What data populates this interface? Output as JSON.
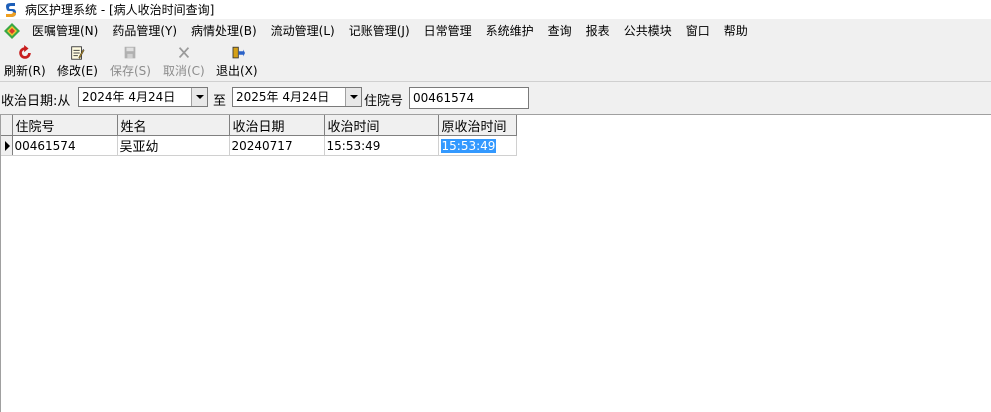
{
  "window": {
    "title": "病区护理系统 - [病人收治时间查询]"
  },
  "menubar": {
    "items": [
      "医嘱管理(N)",
      "药品管理(Y)",
      "病情处理(B)",
      "流动管理(L)",
      "记账管理(J)",
      "日常管理",
      "系统维护",
      "查询",
      "报表",
      "公共模块",
      "窗口",
      "帮助"
    ]
  },
  "toolbar": {
    "refresh_label": "刷新(R)",
    "edit_label": "修改(E)",
    "save_label": "保存(S)",
    "cancel_label": "取消(C)",
    "exit_label": "退出(X)",
    "save_enabled": false,
    "cancel_enabled": false
  },
  "filter": {
    "date_label": "收治日期:从",
    "from_date": "2024年 4月24日",
    "to_label": "至",
    "to_date": "2025年 4月24日",
    "inpatient_label": "住院号",
    "inpatient_value": "00461574"
  },
  "grid": {
    "columns": [
      "住院号",
      "姓名",
      "收治日期",
      "收治时间",
      "原收治时间"
    ],
    "rows": [
      {
        "inpatient_no": "00461574",
        "name": "吴亚幼",
        "admit_date": "20240717",
        "admit_time": "15:53:49",
        "orig_admit_time": "15:53:49"
      }
    ],
    "selection_color": "#3399ff"
  },
  "icons": {
    "app": "app-icon",
    "mdi": "mdi-child-icon",
    "refresh": "refresh-icon",
    "edit": "edit-icon",
    "save": "save-disk-icon",
    "cancel": "cancel-x-icon",
    "exit": "exit-door-icon"
  }
}
